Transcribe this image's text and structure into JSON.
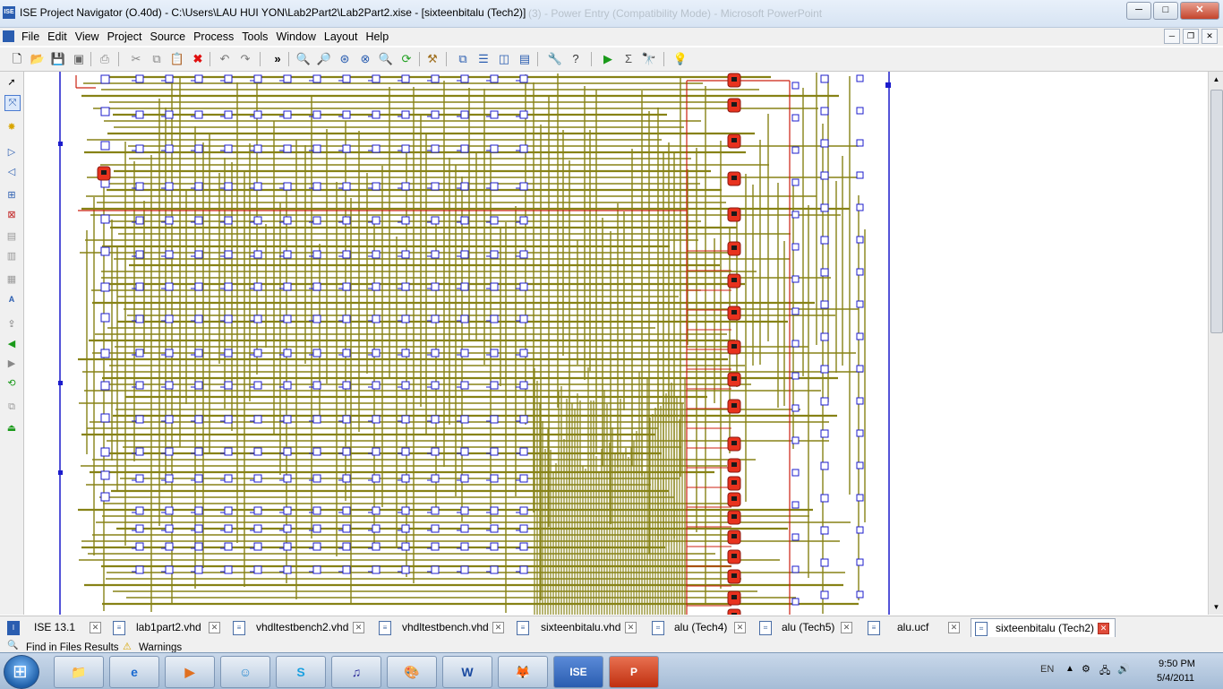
{
  "window": {
    "title": "ISE Project Navigator (O.40d) - C:\\Users\\LAU HUI YON\\Lab2Part2\\Lab2Part2.xise - [sixteenbitalu (Tech2)]",
    "background_title": "(3) - Power Entry (Compatibility Mode) - Microsoft PowerPoint",
    "minimize": "─",
    "maximize": "□",
    "close": "✕"
  },
  "menu": {
    "items": [
      "File",
      "Edit",
      "View",
      "Project",
      "Source",
      "Process",
      "Tools",
      "Window",
      "Layout",
      "Help"
    ]
  },
  "toolbar": {
    "more": "»"
  },
  "tabs": [
    {
      "label": "ISE 13.1",
      "icon": "ise-icon"
    },
    {
      "label": "lab1part2.vhd",
      "icon": "document-icon"
    },
    {
      "label": "vhdltestbench2.vhd",
      "icon": "document-icon"
    },
    {
      "label": "vhdltestbench.vhd",
      "icon": "document-icon"
    },
    {
      "label": "sixteenbitalu.vhd",
      "icon": "document-icon"
    },
    {
      "label": "alu (Tech4)",
      "icon": "schematic-icon"
    },
    {
      "label": "alu (Tech5)",
      "icon": "schematic-icon"
    },
    {
      "label": "alu.ucf",
      "icon": "document-icon"
    },
    {
      "label": "sixteenbitalu (Tech2)",
      "icon": "schematic-icon",
      "active": true
    }
  ],
  "panels": {
    "find": "Find in Files Results",
    "warnings": "Warnings"
  },
  "taskbar": {
    "ise_label": "ISE",
    "language": "EN",
    "time": "9:50 PM",
    "date": "5/4/2011"
  },
  "colors": {
    "wire": "#878216",
    "gate": "#1c1ccc",
    "highlight": "#cc2010",
    "marker": "#e8321e"
  }
}
